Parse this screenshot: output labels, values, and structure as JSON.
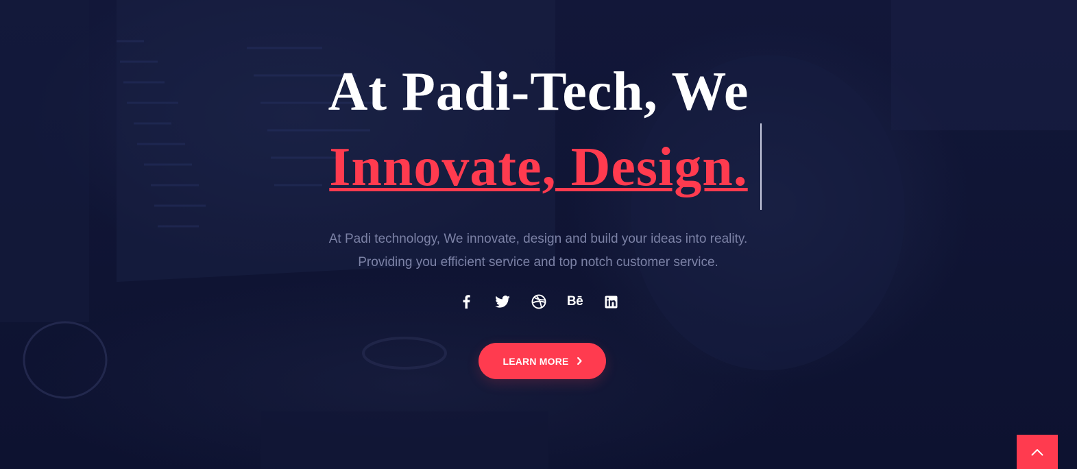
{
  "hero": {
    "title_line_1": "At Padi-Tech, We",
    "title_line_2": "Innovate, Design.",
    "subtitle_line_1": "At Padi technology, We innovate, design and build your ideas into reality.",
    "subtitle_line_2": "Providing you efficient service and top notch customer service.",
    "cta_label": "LEARN MORE"
  },
  "social": {
    "items": [
      {
        "icon": "facebook-icon"
      },
      {
        "icon": "twitter-icon"
      },
      {
        "icon": "dribbble-icon"
      },
      {
        "icon": "behance-icon",
        "text": "Bē"
      },
      {
        "icon": "linkedin-icon"
      }
    ]
  },
  "colors": {
    "background": "#0f1433",
    "accent": "#ff3b4f",
    "title": "#ffffff",
    "subtitle": "#7c82a6"
  },
  "back_to_top": {
    "icon": "chevron-up-icon"
  }
}
